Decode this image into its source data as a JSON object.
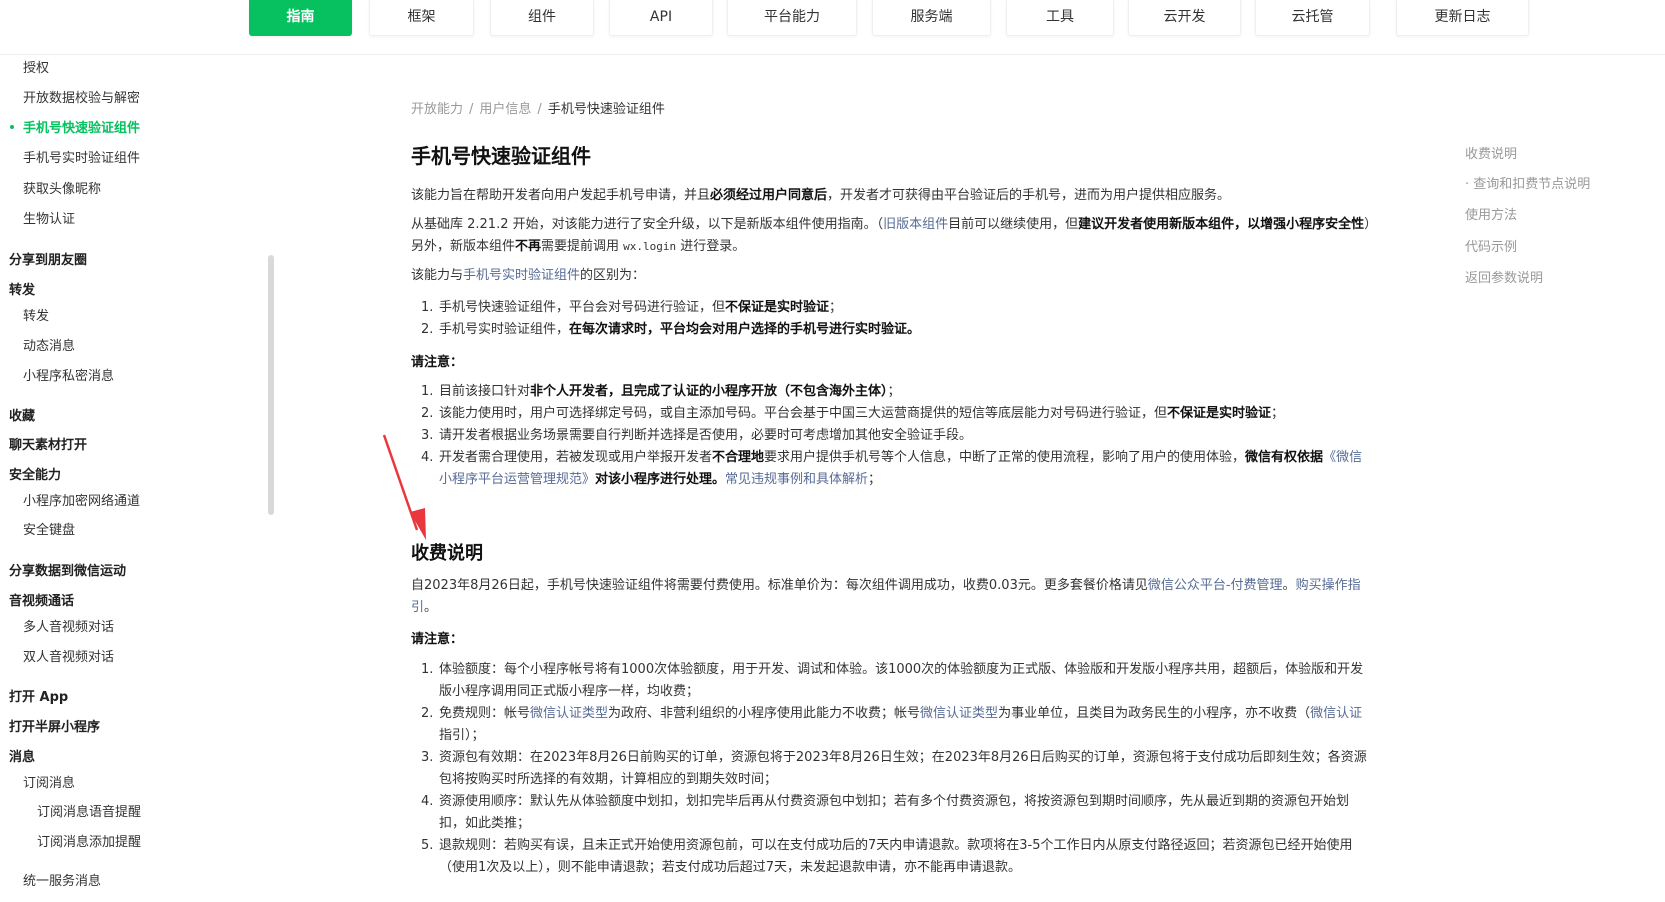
{
  "topnav": {
    "tabs": [
      {
        "label": "指南"
      },
      {
        "label": "框架"
      },
      {
        "label": "组件"
      },
      {
        "label": "API"
      },
      {
        "label": "平台能力"
      },
      {
        "label": "服务端"
      },
      {
        "label": "工具"
      },
      {
        "label": "云开发"
      },
      {
        "label": "云托管"
      },
      {
        "label": "更新日志"
      }
    ]
  },
  "sidebar": {
    "items": [
      {
        "label": "授权"
      },
      {
        "label": "开放数据校验与解密"
      },
      {
        "label": "手机号快速验证组件"
      },
      {
        "label": "手机号实时验证组件"
      },
      {
        "label": "获取头像昵称"
      },
      {
        "label": "生物认证"
      },
      {
        "label": "分享到朋友圈"
      },
      {
        "label": "转发"
      },
      {
        "label": "转发"
      },
      {
        "label": "动态消息"
      },
      {
        "label": "小程序私密消息"
      },
      {
        "label": "收藏"
      },
      {
        "label": "聊天素材打开"
      },
      {
        "label": "安全能力"
      },
      {
        "label": "小程序加密网络通道"
      },
      {
        "label": "安全键盘"
      },
      {
        "label": "分享数据到微信运动"
      },
      {
        "label": "音视频通话"
      },
      {
        "label": "多人音视频对话"
      },
      {
        "label": "双人音视频对话"
      },
      {
        "label": "打开 App"
      },
      {
        "label": "打开半屏小程序"
      },
      {
        "label": "消息"
      },
      {
        "label": "订阅消息"
      },
      {
        "label": "订阅消息语音提醒"
      },
      {
        "label": "订阅消息添加提醒"
      },
      {
        "label": "统一服务消息"
      }
    ]
  },
  "breadcrumb": {
    "items": [
      "开放能力",
      "用户信息",
      "手机号快速验证组件"
    ],
    "separator": "/"
  },
  "page": {
    "title": "手机号快速验证组件",
    "intro": {
      "a": "该能力旨在帮助开发者向用户发起手机号申请，并且",
      "b": "必须经过用户同意后",
      "c": "，开发者才可获得由平台验证后的手机号，进而为用户提供相应服务。"
    },
    "upgrade": {
      "a": "从基础库 2.21.2 开始，对该能力进行了安全升级，以下是新版本组件使用指南。（",
      "link": "旧版本组件",
      "b": "目前可以继续使用，但",
      "c": "建议开发者使用新版本组件，以增强小程序安全性",
      "d": "）另外，新版本组件",
      "e": "不再",
      "f": "需要提前调用 ",
      "code": "wx.login",
      "g": " 进行登录。"
    },
    "diff": {
      "a": "该能力与",
      "link": "手机号实时验证组件",
      "b": "的区别为："
    },
    "diff_list": [
      {
        "num": "1.",
        "a": "手机号快速验证组件，平台会对号码进行验证，但",
        "b": "不保证是实时验证",
        "c": "；"
      },
      {
        "num": "2.",
        "a": "手机号实时验证组件，",
        "b": "在每次请求时，平台均会对用户选择的手机号进行实时验证。",
        "c": ""
      }
    ],
    "notice_label": "请注意：",
    "notice_list": {
      "item1": {
        "num": "1.",
        "a": "目前该接口针对",
        "b": "非个人开发者，且完成了认证的小程序开放（不包含海外主体）",
        "c": "；"
      },
      "item2": {
        "num": "2.",
        "a": "该能力使用时，用户可选择绑定号码，或自主添加号码。平台会基于中国三大运营商提供的短信等底层能力对号码进行验证，但",
        "b": "不保证是实时验证",
        "c": "；"
      },
      "item3": {
        "num": "3.",
        "a": "请开发者根据业务场景需要自行判断并选择是否使用，必要时可考虑增加其他安全验证手段。"
      },
      "item4": {
        "num": "4.",
        "a": "开发者需合理使用，若被发现或用户举报开发者",
        "b": "不合理地",
        "c": "要求用户提供手机号等个人信息，中断了正常的使用流程，影响了用户的使用体验，",
        "d": "微信有权依据",
        "link": "《微信小程序平台运营管理规范》",
        "e": "对该小程序进行处理。",
        "link2": "常见违规事例和具体解析",
        "f": "；"
      }
    },
    "fee": {
      "heading": "收费说明",
      "text_a": "自2023年8月26日起，手机号快速验证组件将需要付费使用。标准单价为：每次组件调用成功，收费0.03元。更多套餐价格请见",
      "link": "微信公众平台-付费管理",
      "text_b": "。",
      "link2": "购买操作指引",
      "text_c": "。",
      "notice_label": "请注意：",
      "item1": {
        "num": "1.",
        "a": "体验额度：每个小程序帐号将有1000次体验额度，用于开发、调试和体验。该1000次的体验额度为正式版、体验版和开发版小程序共用，超额后，体验版和开发版小程序调用同正式版小程序一样，均收费；"
      },
      "item2": {
        "num": "2.",
        "a": "免费规则：帐号",
        "link": "微信认证类型",
        "b": "为政府、非营利组织的小程序使用此能力不收费；帐号",
        "link2": "微信认证类型",
        "c": "为事业单位，且类目为政务民生的小程序，亦不收费（",
        "link3": "微信认证",
        "d": "指引）；"
      },
      "item3": {
        "num": "3.",
        "a": "资源包有效期：在2023年8月26日前购买的订单，资源包将于2023年8月26日生效；在2023年8月26日后购买的订单，资源包将于支付成功后即刻生效；各资源包将按购买时所选择的有效期，计算相应的到期失效时间；"
      },
      "item4": {
        "num": "4.",
        "a": "资源使用顺序：默认先从体验额度中划扣，划扣完毕后再从付费资源包中划扣；若有多个付费资源包，将按资源包到期时间顺序，先从最近到期的资源包开始划扣，如此类推；"
      },
      "item5": {
        "num": "5.",
        "a": "退款规则：若购买有误，且未正式开始使用资源包前，可以在支付成功后的7天内申请退款。款项将在3-5个工作日内从原支付路径返回；若资源包已经开始使用（使用1次及以上），则不能申请退款；若支付成功后超过7天，未发起退款申请，亦不能再申请退款。"
      }
    }
  },
  "toc": {
    "items": [
      {
        "label": "收费说明"
      },
      {
        "label": "· 查询和扣费节点说明"
      },
      {
        "label": "使用方法"
      },
      {
        "label": "代码示例"
      },
      {
        "label": "返回参数说明"
      }
    ]
  },
  "colors": {
    "accent": "#07c160",
    "link": "#576b95",
    "annotation": "#e8383d"
  }
}
